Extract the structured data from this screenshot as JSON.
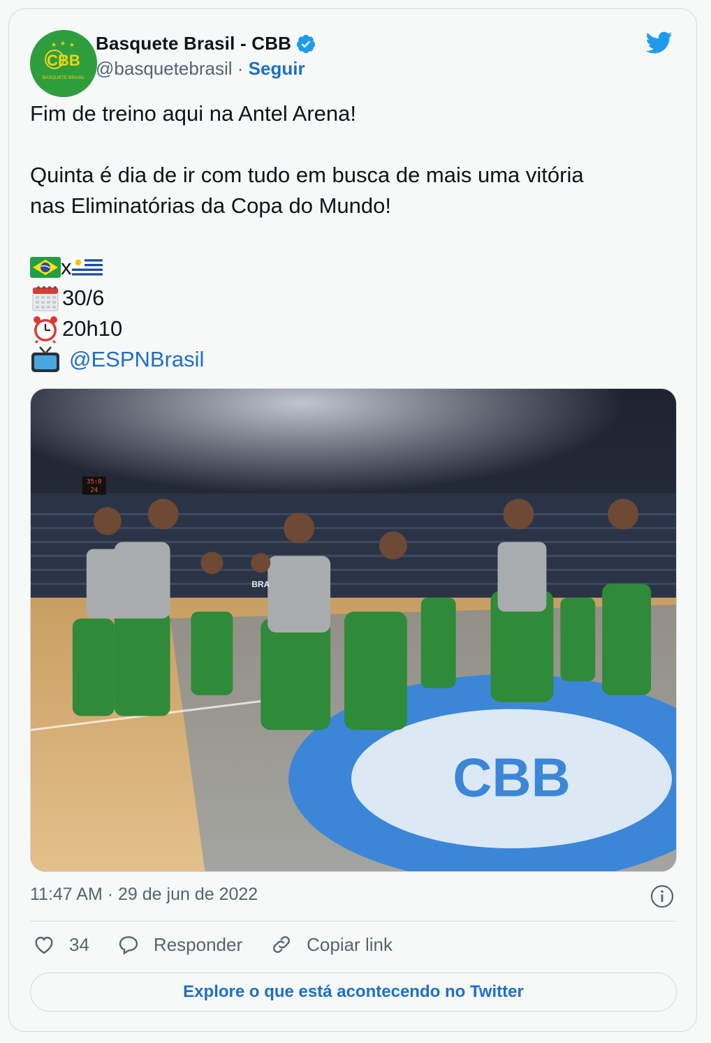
{
  "author": {
    "name": "Basquete Brasil - CBB",
    "handle": "@basquetebrasil",
    "separator": "·",
    "follow_label": "Seguir",
    "avatar_text": "CBB",
    "avatar_subtext": "BASQUETE BRASIL",
    "verified": true
  },
  "tweet": {
    "line1": "Fim de treino aqui na Antel Arena!",
    "line2": "Quinta é dia de ir com tudo em busca de mais uma vitória",
    "line3": "nas Eliminatórias da Copa do Mundo!",
    "match_vs": "x",
    "date": "30/6",
    "time": "20h10",
    "broadcaster": "@ESPNBrasil",
    "icons": [
      "brazil-flag",
      "uruguay-flag",
      "calendar",
      "alarm-clock",
      "television"
    ]
  },
  "media": {
    "scoreboard_top": "35:0",
    "scoreboard_bottom": "24",
    "jersey_text": "BRA",
    "court_logo": "CBB"
  },
  "timestamp": {
    "time": "11:47 AM",
    "separator": "·",
    "date": "29 de jun de 2022"
  },
  "actions": {
    "likes": "34",
    "reply_label": "Responder",
    "copy_label": "Copiar link"
  },
  "explore_label": "Explore o que está acontecendo no Twitter",
  "colors": {
    "link": "#1d6fc8",
    "twitter_blue": "#1d9bf0",
    "muted": "#536471",
    "border": "#cfd9de",
    "background": "#f7f9f9"
  }
}
